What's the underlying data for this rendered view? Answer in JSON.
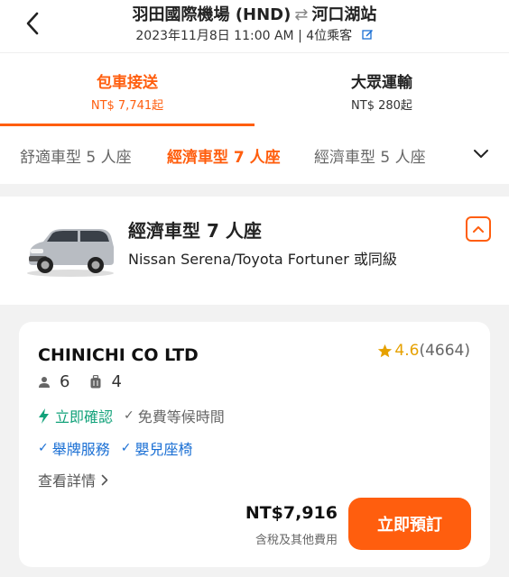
{
  "header": {
    "origin": "羽田國際機場 (HND)",
    "swap_symbol": "⇄",
    "destination": "河口湖站",
    "meta": "2023年11月8日 11:00 AM | 4位乘客"
  },
  "tabs": [
    {
      "title": "包車接送",
      "price": "NT$ 7,741起"
    },
    {
      "title": "大眾運輸",
      "price": "NT$ 280起"
    }
  ],
  "car_types": [
    "舒適車型 5 人座",
    "經濟車型 7 人座",
    "經濟車型 5 人座"
  ],
  "selected_car": {
    "title": "經濟車型 7 人座",
    "description": "Nissan Serena/Toyota Fortuner 或同級"
  },
  "offer": {
    "vendor": "CHINICHI CO LTD",
    "rating": "4.6",
    "reviews": "(4664)",
    "passengers": "6",
    "luggage": "4",
    "instant": "立即確認",
    "free_wait": "免費等候時間",
    "feature_a": "舉牌服務",
    "feature_b": "嬰兒座椅",
    "details": "查看詳情",
    "price": "NT$7,916",
    "tax_note": "含稅及其他費用",
    "book_label": "立即預訂"
  },
  "colors": {
    "accent": "#ff5e0e",
    "green": "#12a27a",
    "blue": "#1a6fd4",
    "star": "#e6a100"
  },
  "icons": [
    "back-arrow-icon",
    "edit-icon",
    "chevron-down-icon",
    "chevron-up-icon",
    "person-icon",
    "luggage-icon",
    "bolt-icon",
    "check-icon",
    "chevron-right-icon",
    "star-icon"
  ]
}
